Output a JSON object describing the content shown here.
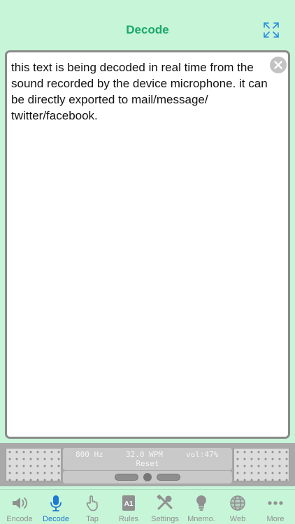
{
  "nav": {
    "title": "Decode",
    "expand_icon": "expand-icon",
    "title_color": "#1aa86a"
  },
  "text_area": {
    "content": "this text is being decoded in real time from the sound recorded by the device microphone. it can be directly exported to mail/message/ twitter/facebook.",
    "clear_icon": "clear-circle-icon"
  },
  "meter": {
    "frequency": "800 Hz",
    "wpm": "32.0 WPM",
    "volume": "vol:47%",
    "reset_label": "Reset"
  },
  "tabs": [
    {
      "label": "Encode",
      "icon": "speaker-icon",
      "active": false
    },
    {
      "label": "Decode",
      "icon": "microphone-icon",
      "active": true
    },
    {
      "label": "Tap",
      "icon": "tap-hand-icon",
      "active": false
    },
    {
      "label": "Rules",
      "icon": "rules-book-icon",
      "active": false
    },
    {
      "label": "Settings",
      "icon": "tools-icon",
      "active": false
    },
    {
      "label": "Mnemo.",
      "icon": "lightbulb-icon",
      "active": false
    },
    {
      "label": "Web",
      "icon": "globe-icon",
      "active": false
    },
    {
      "label": "More",
      "icon": "more-dots-icon",
      "active": false
    }
  ],
  "colors": {
    "background": "#c6f5d8",
    "active_tab": "#1f78d1",
    "inactive_tab": "#909090"
  }
}
